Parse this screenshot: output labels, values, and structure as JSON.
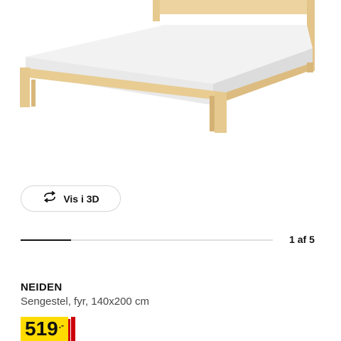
{
  "product": {
    "image_alt_icon": "bed-frame-image",
    "name": "NEIDEN",
    "description": "Sengestel, fyr, 140x200 cm",
    "price": {
      "value": "519",
      "suffix": ".-",
      "background_color": "#ffdb00",
      "accent_color": "#cc0008"
    }
  },
  "viewer": {
    "view3d_label": "Vis i 3D",
    "view3d_icon": "rotate-3d-icon"
  },
  "carousel": {
    "position_text": "1 af 5",
    "progress_fraction": 0.2
  }
}
